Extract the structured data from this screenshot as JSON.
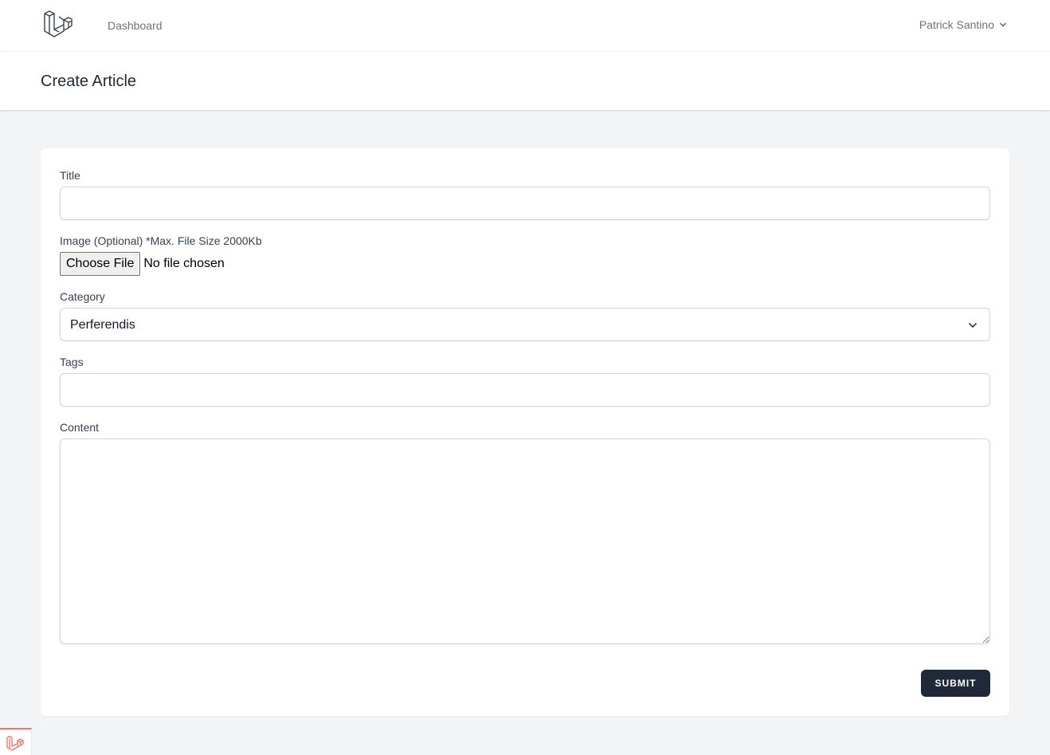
{
  "nav": {
    "logo_icon": "laravel-logo-icon",
    "dashboard_link": "Dashboard",
    "user_name": "Patrick Santino",
    "user_chevron_icon": "chevron-down-icon"
  },
  "header": {
    "title": "Create Article"
  },
  "form": {
    "title_label": "Title",
    "title_value": "",
    "image_label": "Image (Optional) *Max. File Size 2000Kb",
    "file_button_label": "Choose File",
    "file_status": "No file chosen",
    "category_label": "Category",
    "category_selected": "Perferendis",
    "category_chevron_icon": "chevron-down-icon",
    "tags_label": "Tags",
    "tags_value": "",
    "content_label": "Content",
    "content_value": "",
    "submit_label": "SUBMIT"
  },
  "debug_bar": {
    "icon": "laravel-debugbar-icon",
    "accent_color": "#f87171"
  },
  "colors": {
    "page_background": "#f3f4f6",
    "card_background": "#ffffff",
    "submit_button": "#1f2937",
    "border": "#d1d5db",
    "label_text": "#374151",
    "muted_text": "#6b7280"
  }
}
